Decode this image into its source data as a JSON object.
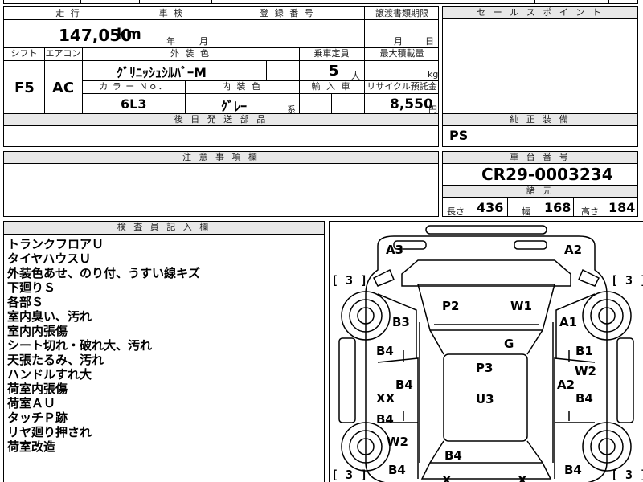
{
  "top_strip": {
    "partial": "走行"
  },
  "mileage": {
    "header": "走 行",
    "value": "147,050",
    "unit": "km"
  },
  "shaken": {
    "header": "車 検",
    "year": "年",
    "month": "月"
  },
  "registration": {
    "header": "登 録 番 号"
  },
  "transfer_deadline": {
    "header": "譲渡書類期限",
    "month": "月",
    "day": "日"
  },
  "shift": {
    "header": "シフト",
    "value": "F5"
  },
  "aircon": {
    "header": "エアコン",
    "value": "AC"
  },
  "exterior_color": {
    "header": "外 装 色",
    "value": "ｸﾞﾘﾆｯｼｭｼﾙﾊﾞｰM"
  },
  "capacity": {
    "header": "乗車定員",
    "value": "5",
    "unit": "人"
  },
  "max_load": {
    "header": "最大積載量",
    "unit": "kg"
  },
  "color_no": {
    "header": "カ ラ ー Ｎｏ．",
    "value": "6L3"
  },
  "interior_color": {
    "header": "内 装 色",
    "value": "ｸﾞﾚｰ",
    "suffix": "系"
  },
  "import": {
    "header": "輸 入 車"
  },
  "recycle": {
    "header": "リサイクル預託金",
    "value": "8,550",
    "unit": "円"
  },
  "later_parts": {
    "header": "後 日 発 送 部 品"
  },
  "sales_point": {
    "header": "セ ー ル ス ポ イ ン ト"
  },
  "genuine_equipment": {
    "header": "純 正 装 備",
    "value": "PS"
  },
  "caution": {
    "header": "注 意 事 項 欄"
  },
  "chassis": {
    "header": "車 台 番 号",
    "value": "CR29-0003234"
  },
  "specs": {
    "header": "諸 元",
    "length_label": "長さ",
    "length": "436",
    "width_label": "幅",
    "width": "168",
    "height_label": "高さ",
    "height": "184"
  },
  "inspector": {
    "header": "検 査 員 記 入 欄",
    "notes": [
      "トランクフロアＵ",
      "タイヤハウスＵ",
      "外装色あせ、のり付、うすい線キズ",
      "下廻りＳ",
      "各部Ｓ",
      "室内臭い、汚れ",
      "室内内張傷",
      "シート切れ・破れ大、汚れ",
      "天張たるみ、汚れ",
      "ハンドルすれ大",
      "荷室内張傷",
      "荷室ＡＵ",
      "タッチＰ跡",
      "リヤ廻り押され",
      "荷室改造"
    ]
  },
  "diagram": {
    "tire_marks": [
      "[ 3 ]",
      "[ 3 ]",
      "[ 3 ]",
      "[ 3 ]"
    ],
    "labels": {
      "a3": "A3",
      "a2_top": "A2",
      "p2": "P2",
      "w1": "W1",
      "b3": "B3",
      "a1": "A1",
      "g": "G",
      "b4_l1": "B4",
      "b1": "B1",
      "p3": "P3",
      "w2_r": "W2",
      "b4_c": "B4",
      "a2_mid": "A2",
      "xx": "XX",
      "u3": "U3",
      "b4_r1": "B4",
      "b4_l2": "B4",
      "w2_l": "W2",
      "b4_bc": "B4",
      "b4_bl": "B4",
      "b4_br": "B4",
      "x_l": "X",
      "x_r": "X"
    }
  }
}
